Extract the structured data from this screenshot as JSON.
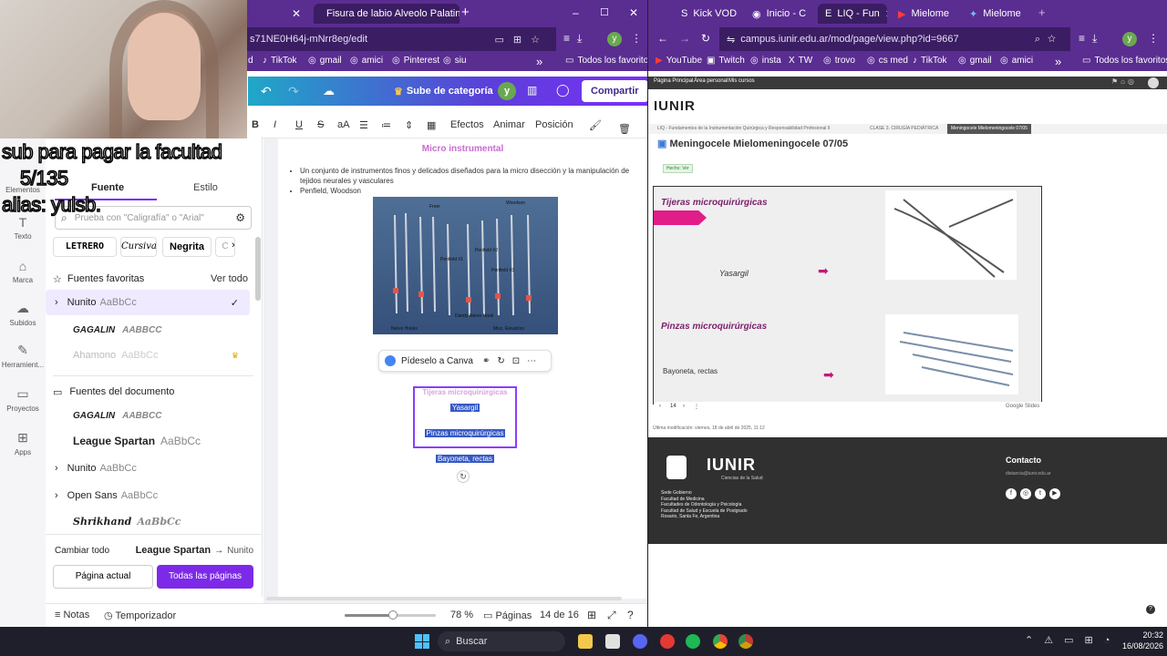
{
  "left_browser": {
    "tabs": [
      {
        "label": "Fisura de labio Alveolo Palatina"
      }
    ],
    "new_tab": "+",
    "window_controls": {
      "minimize": "–",
      "maximize": "☐",
      "close": "✕"
    },
    "url": "s71NE0H64j-mNrr8eg/edit",
    "bookmarks": [
      "d",
      "TikTok",
      "gmail",
      "amici",
      "Pinterest",
      "siu"
    ],
    "bookmarks_more": "»",
    "all_bookmarks": "Todos los favoritos",
    "avatar_letter": "y"
  },
  "canva": {
    "upgrade_label": "Sube de categoría",
    "avatar_letter": "y",
    "share_label": "Compartir",
    "format_tools": [
      "B",
      "I",
      "U",
      "S",
      "aA"
    ],
    "format_text": [
      "Efectos",
      "Animar",
      "Posición"
    ],
    "sidebar": [
      {
        "label": "Elementos"
      },
      {
        "label": "Texto"
      },
      {
        "label": "Marca"
      },
      {
        "label": "Subidos"
      },
      {
        "label": "Herramient..."
      },
      {
        "label": "Proyectos"
      },
      {
        "label": "Apps"
      }
    ],
    "font_panel": {
      "tabs": [
        "Fuente",
        "Estilo"
      ],
      "search_placeholder": "Prueba con \"Caligrafía\" o \"Arial\"",
      "chips": [
        "LETRERO",
        "Cursiva",
        "Negrita",
        "C"
      ],
      "favorites_title": "Fuentes favoritas",
      "see_all": "Ver todo",
      "favorites": [
        {
          "name": "Nunito",
          "sample": "AaBbCc",
          "selected": true
        },
        {
          "name": "GAGALIN",
          "sample": "AABBCC"
        },
        {
          "name": "Ahamono",
          "sample": "AaBbCc"
        }
      ],
      "doc_title": "Fuentes del documento",
      "doc_fonts": [
        {
          "name": "GAGALIN",
          "sample": "AABBCC"
        },
        {
          "name": "League Spartan",
          "sample": "AaBbCc"
        },
        {
          "name": "Nunito",
          "sample": "AaBbCc"
        },
        {
          "name": "Open Sans",
          "sample": "AaBbCc"
        },
        {
          "name": "Shrikhand",
          "sample": "AaBbCc"
        }
      ],
      "change_all": "Cambiar todo",
      "from_font": "League Spartan",
      "to_font": "Nunito",
      "arrow": "→",
      "this_page": "Página actual",
      "all_pages": "Todas las páginas"
    },
    "page": {
      "heading": "Micro instrumental",
      "bullets": [
        "Un conjunto de instrumentos finos y delicados diseñados para la micro disección y la manipulación de tejidos neurales y vasculares",
        "Penfield, Woodson"
      ],
      "image_labels": [
        "Freer",
        "Woodson",
        "Penfield #1",
        "Penfield #2",
        "Penfield #3",
        "Penfield #4",
        "Nerve Hooks",
        "Misc. Elevators",
        "Dandy Nerve Hook"
      ],
      "ask_canva": "Pídeselo a Canva",
      "selected_lines": [
        "Tijeras microquirúrgicas",
        "Yasargil",
        "Pinzas microquirúrgicas",
        "Bayoneta, rectas"
      ]
    },
    "footer": {
      "notes": "Notas",
      "timer": "Temporizador",
      "zoom": "78 %",
      "pages_label": "Páginas",
      "page_count": "14 de 16",
      "zoom_level": 0.78
    }
  },
  "right_browser": {
    "tabs": [
      {
        "label": "Kick VOD"
      },
      {
        "label": "Inicio - C"
      },
      {
        "label": "LIQ - Fun"
      },
      {
        "label": "Mielome"
      },
      {
        "label": "Mielome"
      }
    ],
    "new_tab": "+",
    "url": "campus.iunir.edu.ar/mod/page/view.php?id=9667",
    "bookmarks": [
      "YouTube",
      "Twitch",
      "insta",
      "TW",
      "trovo",
      "cs med",
      "TikTok",
      "gmail",
      "amici"
    ],
    "bookmarks_more": "»",
    "all_bookmarks": "Todos los favoritos",
    "avatar_letter": "y",
    "moodle_nav": [
      "Página Principal",
      "Área personal",
      "Mis cursos"
    ],
    "logo_text": "IUNIR",
    "breadcrumb": [
      "LIQ - Fundamentos de la Instrumentación Quirúrgica y Responsabilidad Profesional II",
      "CLASE 3. CIRUGÍA PEDIÁTRICA",
      "Meningocele Mielomeningocele 07/05"
    ],
    "page_title": "Meningocele Mielomeningocele 07/05",
    "done_badge": "Hecho: Ver",
    "slide": {
      "title1": "Tijeras microquirúrgicas",
      "label1": "Yasargil",
      "title2": "Pinzas microquirúrgicas",
      "label2": "Bayoneta, rectas",
      "slide_number": "14",
      "google_slides": "Google Slides"
    },
    "last_modified": "Última modificación: viernes, 18 de abril de 2025, 11:12",
    "footer": {
      "logo": "IUNIR",
      "logo_sub": "Ciencias de la Salud",
      "lines": [
        "Sede Gobierno",
        "Facultad de Medicina",
        "Facultades de Odontología y Psicología",
        "Facultad de Salud y Escuela de Postgrado",
        "Rosario, Santa Fe, Argentina"
      ],
      "contact_title": "Contacto",
      "contact_email": "distancia@iunir.edu.ar"
    }
  },
  "overlay": {
    "line1": "sub para pagar la facultad",
    "line2": "5/135",
    "line3": "alias: yulsb."
  },
  "taskbar": {
    "search_label": "Buscar",
    "time": "20:32",
    "date": "16/08/2026"
  }
}
